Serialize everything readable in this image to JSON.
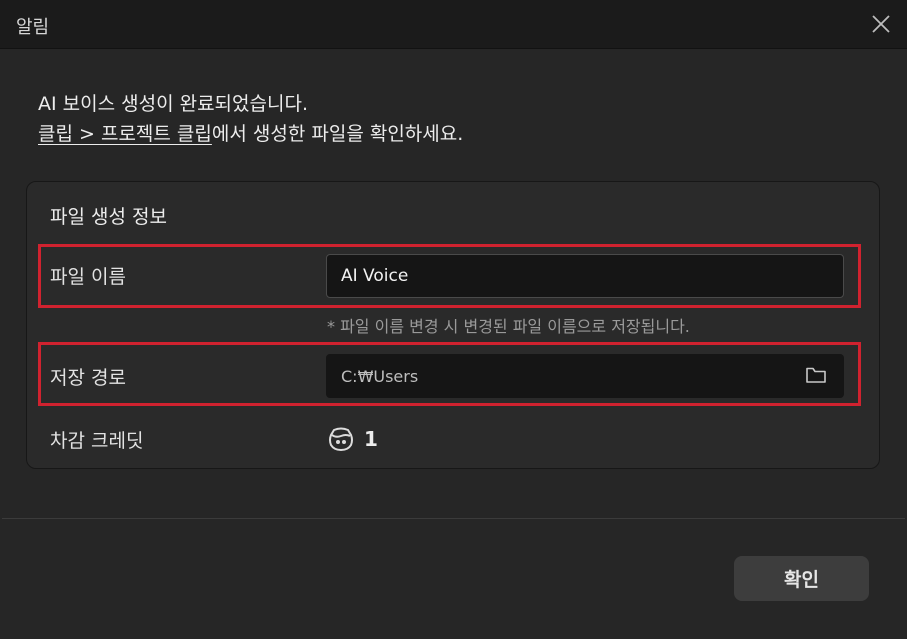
{
  "dialog": {
    "title": "알림"
  },
  "message": {
    "line1": "AI 보이스 생성이 완료되었습니다.",
    "link_text": "클립 > 프로젝트 클립",
    "line2_rest": "에서 생성한 파일을 확인하세요."
  },
  "info_panel": {
    "title": "파일 생성 정보",
    "file_name": {
      "label": "파일 이름",
      "value": "AI Voice",
      "hint": "* 파일 이름 변경 시 변경된 파일 이름으로 저장됩니다."
    },
    "save_path": {
      "label": "저장 경로",
      "value": "C:₩Users"
    },
    "credit": {
      "label": "차감 크레딧",
      "value": "1"
    }
  },
  "footer": {
    "confirm_label": "확인"
  },
  "colors": {
    "highlight": "#d0222f",
    "background": "#262626",
    "titlebar": "#1b1b1b",
    "field_bg": "#151515"
  },
  "icons": {
    "close": "close-icon",
    "folder": "folder-icon",
    "credit": "credit-icon"
  }
}
